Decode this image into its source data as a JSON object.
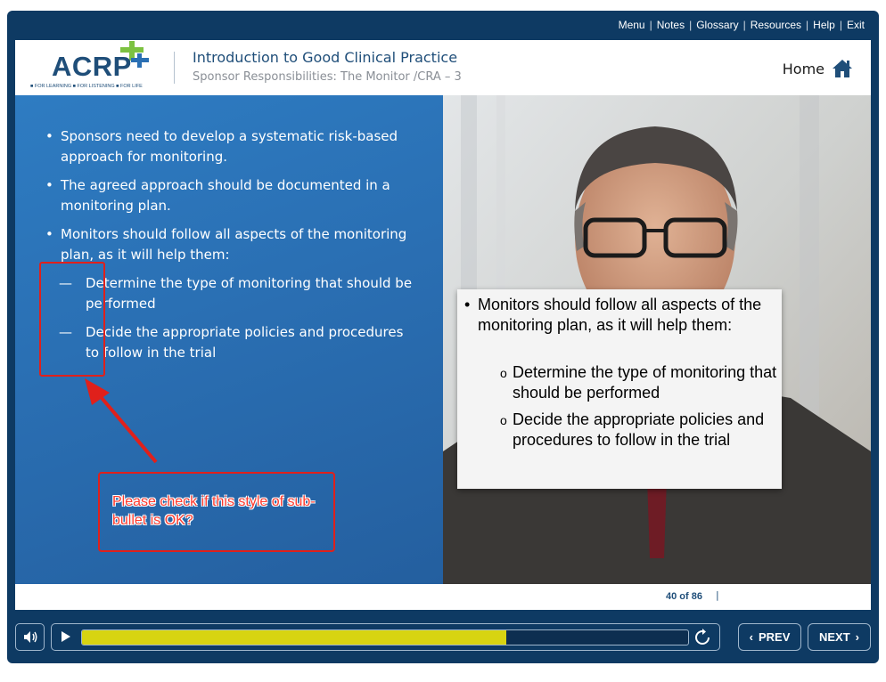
{
  "topnav": [
    "Menu",
    "Notes",
    "Glossary",
    "Resources",
    "Help",
    "Exit"
  ],
  "logo": {
    "text": "ACRP",
    "tagline": "■ FOR LEARNING ■ FOR LISTENING ■ FOR LIFE"
  },
  "header": {
    "title": "Introduction to Good Clinical Practice",
    "subtitle": "Sponsor Responsibilities: The Monitor /CRA – 3",
    "home_label": "Home"
  },
  "slide": {
    "bullets": [
      "Sponsors need to develop a systematic risk-based approach for monitoring.",
      "The agreed approach should be documented in a monitoring plan.",
      "Monitors should follow all aspects of the monitoring plan, as it will help them:"
    ],
    "sub_bullets": [
      "Determine the type of monitoring that should be performed",
      "Decide the appropriate policies and procedures to follow in the trial"
    ],
    "bullet_char": "•",
    "dash_char": "—",
    "review_note": "Please check if this style of sub-bullet is OK?",
    "callout": {
      "bullet": "Monitors should follow all aspects of the monitoring plan, as it will help them:",
      "subs": [
        "Determine the type of monitoring that should be performed",
        "Decide the appropriate policies and procedures to follow in the trial"
      ],
      "sub_marker": "o"
    }
  },
  "footer": {
    "page_counter": "40 of 86",
    "separator": "|"
  },
  "controls": {
    "prev_label": "PREV",
    "next_label": "NEXT",
    "progress": 0.7
  },
  "colors": {
    "frame": "#0e3a63",
    "panel_blue": "#2a6fb3",
    "progress_fill": "#d7d411",
    "annotation_red": "#e0201b",
    "logo_green": "#7dc241"
  },
  "icons": [
    "home-icon",
    "volume-icon",
    "play-icon",
    "replay-icon",
    "chevron-left-icon",
    "chevron-right-icon"
  ]
}
